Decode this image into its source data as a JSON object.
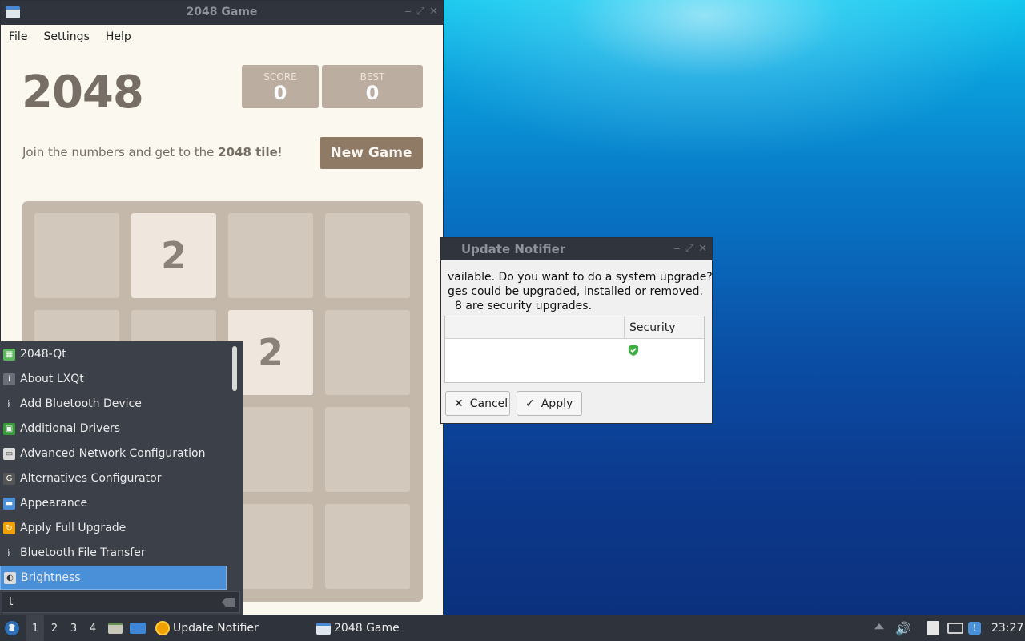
{
  "game_window": {
    "title": "2048 Game",
    "menu": [
      "File",
      "Settings",
      "Help"
    ],
    "logo": "2048",
    "score_label": "SCORE",
    "score_value": "0",
    "best_label": "BEST",
    "best_value": "0",
    "tagline_prefix": "Join the numbers and get to the ",
    "tagline_bold": "2048 tile",
    "tagline_suffix": "!",
    "new_game": "New Game",
    "tiles": [
      [
        "",
        "2",
        "",
        ""
      ],
      [
        "",
        "",
        "2",
        ""
      ],
      [
        "",
        "",
        "",
        ""
      ],
      [
        "",
        "",
        "",
        ""
      ]
    ]
  },
  "notifier": {
    "title": "Update Notifier",
    "line1": "vailable. Do you want to do a system upgrade?",
    "line2": "ges could be upgraded, installed or removed.",
    "line3": "8 are security upgrades.",
    "col_security": "Security",
    "cancel": "Cancel",
    "apply": "Apply"
  },
  "app_menu": {
    "items": [
      {
        "label": "2048-Qt",
        "icon": "2048-icon",
        "color": "#5cb85c"
      },
      {
        "label": "About LXQt",
        "icon": "info-icon",
        "color": "#6a6e76"
      },
      {
        "label": "Add Bluetooth Device",
        "icon": "bluetooth-icon",
        "color": "#3c4049"
      },
      {
        "label": "Additional Drivers",
        "icon": "chip-icon",
        "color": "#3a9a3a"
      },
      {
        "label": "Advanced Network Configuration",
        "icon": "network-icon",
        "color": "#dcdcdc"
      },
      {
        "label": "Alternatives Configurator",
        "icon": "alternatives-icon",
        "color": "#555"
      },
      {
        "label": "Appearance",
        "icon": "appearance-icon",
        "color": "#4a90d9"
      },
      {
        "label": "Apply Full Upgrade",
        "icon": "upgrade-icon",
        "color": "#f0a000"
      },
      {
        "label": "Bluetooth File Transfer",
        "icon": "bluetooth-icon",
        "color": "#3c4049"
      },
      {
        "label": "Brightness",
        "icon": "brightness-icon",
        "color": "#dcdcdc"
      }
    ],
    "search_value": "t"
  },
  "taskbar": {
    "desktops": [
      "1",
      "2",
      "3",
      "4"
    ],
    "tasks": [
      "Update Notifier",
      "2048 Game"
    ],
    "clock": "23:27"
  }
}
